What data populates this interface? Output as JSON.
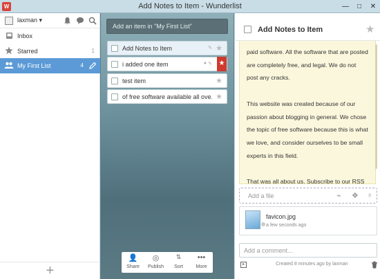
{
  "window": {
    "title": "Add Notes to Item - Wunderlist",
    "app_icon": "W",
    "buttons": {
      "minimize": "—",
      "maximize": "□",
      "close": "✕"
    }
  },
  "sidebar": {
    "user": "laxman ▾",
    "items": [
      {
        "label": "Inbox",
        "count": "",
        "icon": "inbox-icon"
      },
      {
        "label": "Starred",
        "count": "1",
        "icon": "star-icon"
      },
      {
        "label": "My First List",
        "count": "4",
        "icon": "users-icon",
        "selected": true
      }
    ],
    "add_label": "+"
  },
  "center": {
    "add_placeholder": "Add an item in \"My First List\"",
    "tasks": [
      {
        "title": "Add Notes to Item",
        "starred": false,
        "selected": true
      },
      {
        "title": "i added one item",
        "starred": true
      },
      {
        "title": "test item",
        "starred": false
      },
      {
        "title": "of free software available all ove...",
        "starred": false
      }
    ],
    "toolbar": [
      {
        "label": "Share",
        "icon": "share-icon"
      },
      {
        "label": "Publish",
        "icon": "publish-icon"
      },
      {
        "label": "Sort",
        "icon": "sort-icon"
      },
      {
        "label": "More",
        "icon": "more-icon"
      }
    ]
  },
  "detail": {
    "title": "Add Notes to Item",
    "notes": [
      "paid software. All the software that are posted are completely free, and legal. We do not post any cracks.",
      "This website was created because of our passion about blogging in general. We chose the topic of free software because this is what we love, and consider ourselves to be small experts in this field.",
      "That was all about us. Subscribe to our RSS feed, or follow us on Twitter to keep yourself updated as we find best free software for you."
    ],
    "add_file_placeholder": "Add a file",
    "file": {
      "name": "favicon.jpg",
      "time": "a few seconds ago"
    },
    "comment_placeholder": "Add a comment...",
    "created": "Created 8 minutes ago by laxman"
  },
  "colors": {
    "accent": "#5b9ad6",
    "star_red": "#d0392e"
  }
}
